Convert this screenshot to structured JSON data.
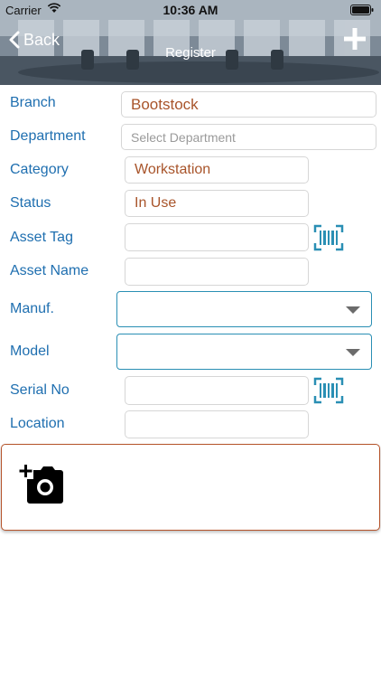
{
  "status_bar": {
    "carrier": "Carrier",
    "time": "10:36 AM"
  },
  "header": {
    "back_label": "Back",
    "title": "Register"
  },
  "form": {
    "branch": {
      "label": "Branch",
      "value": "Bootstock"
    },
    "department": {
      "label": "Department",
      "placeholder": "Select Department"
    },
    "category": {
      "label": "Category",
      "value": "Workstation"
    },
    "status": {
      "label": "Status",
      "value": "In Use"
    },
    "asset_tag": {
      "label": "Asset Tag",
      "value": ""
    },
    "asset_name": {
      "label": "Asset Name",
      "value": ""
    },
    "manuf": {
      "label": "Manuf.",
      "value": ""
    },
    "model": {
      "label": "Model",
      "value": ""
    },
    "serial_no": {
      "label": "Serial No",
      "value": ""
    },
    "location": {
      "label": "Location",
      "value": ""
    }
  },
  "icons": {
    "back": "chevron-left-icon",
    "add": "plus-icon",
    "scan": "barcode-icon",
    "camera": "add-photo-icon"
  },
  "colors": {
    "label": "#1f6fb0",
    "value": "#a8542a",
    "select_border": "#2a8fb4",
    "photo_border": "#b5532a",
    "scan_icon": "#2a8fb4"
  }
}
